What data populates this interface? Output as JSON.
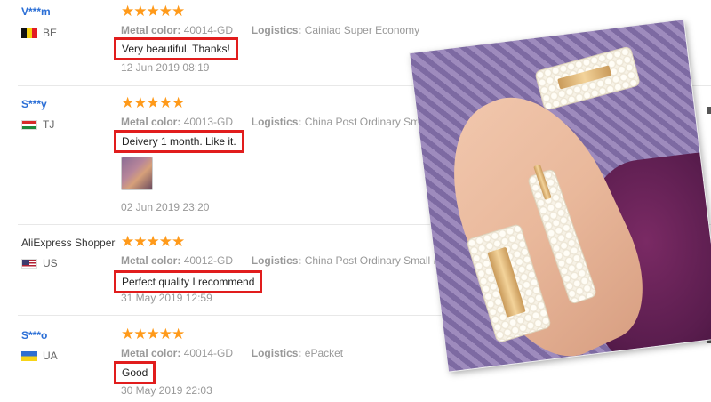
{
  "reviews": [
    {
      "buyer": "V***m",
      "country": "BE",
      "stars": "★★★★★",
      "attr_label": "Metal color:",
      "attr_value": "40014-GD",
      "logistics_label": "Logistics:",
      "logistics_value": "Cainiao Super Economy",
      "feedback": "Very beautiful. Thanks!",
      "date": "12 Jun 2019 08:19"
    },
    {
      "buyer": "S***y",
      "country": "TJ",
      "stars": "★★★★★",
      "attr_label": "Metal color:",
      "attr_value": "40013-GD",
      "logistics_label": "Logistics:",
      "logistics_value": "China Post Ordinary Small Packe",
      "feedback": "Deivery 1 month. Like it.",
      "date": "02 Jun 2019 23:20"
    },
    {
      "buyer": "AliExpress Shopper",
      "country": "US",
      "stars": "★★★★★",
      "attr_label": "Metal color:",
      "attr_value": "40012-GD",
      "logistics_label": "Logistics:",
      "logistics_value": "China Post Ordinary Small Packet Pl",
      "feedback": "Perfect quality I recommend",
      "date": "31 May 2019 12:59"
    },
    {
      "buyer": "S***o",
      "country": "UA",
      "stars": "★★★★★",
      "attr_label": "Metal color:",
      "attr_value": "40014-GD",
      "logistics_label": "Logistics:",
      "logistics_value": "ePacket",
      "feedback": "Good",
      "date": "30 May 2019 22:03"
    }
  ],
  "colors": {
    "link_blue": "#2a6ed6",
    "star_orange": "#ff9a1a",
    "highlight_red": "#e11d1d",
    "meta_gray": "#999999"
  }
}
